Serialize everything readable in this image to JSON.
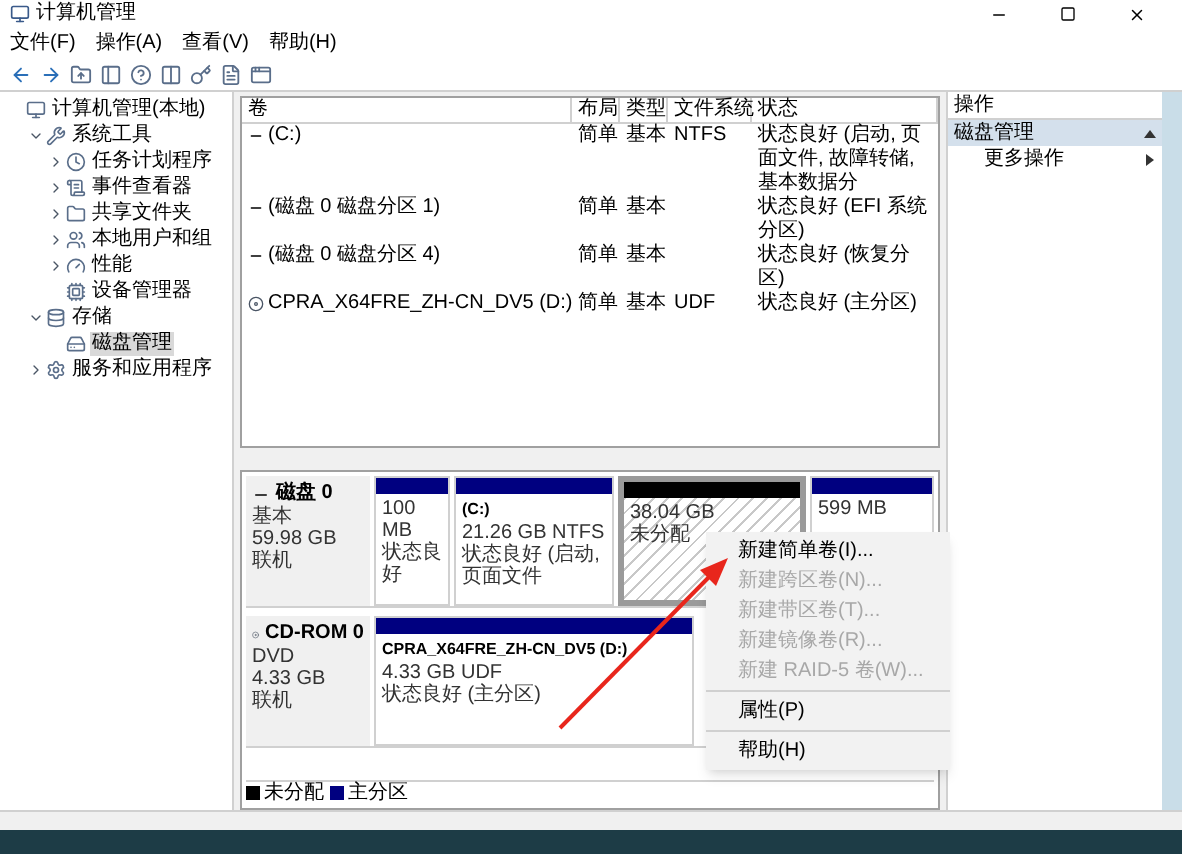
{
  "window": {
    "title": "计算机管理"
  },
  "menu": [
    "文件(F)",
    "操作(A)",
    "查看(V)",
    "帮助(H)"
  ],
  "tree": [
    {
      "label": "计算机管理(本地)",
      "selected": false,
      "children": [
        {
          "label": "系统工具",
          "expanded": true,
          "selected": false,
          "children": [
            {
              "label": "任务计划程序",
              "expanded": false,
              "selected": false
            },
            {
              "label": "事件查看器",
              "expanded": false,
              "selected": false
            },
            {
              "label": "共享文件夹",
              "expanded": false,
              "selected": false
            },
            {
              "label": "本地用户和组",
              "expanded": false,
              "selected": false
            },
            {
              "label": "性能",
              "expanded": false,
              "selected": false
            },
            {
              "label": "设备管理器",
              "selected": false
            }
          ]
        },
        {
          "label": "存储",
          "expanded": true,
          "selected": false,
          "children": [
            {
              "label": "磁盘管理",
              "selected": true
            }
          ]
        },
        {
          "label": "服务和应用程序",
          "expanded": false,
          "selected": false
        }
      ]
    }
  ],
  "table": {
    "columns": [
      "卷",
      "布局",
      "类型",
      "文件系统",
      "状态"
    ],
    "rows": [
      {
        "kind": "partition",
        "cells": [
          "(C:)",
          "简单",
          "基本",
          "NTFS",
          "状态良好 (启动, 页面文件, 故障转储, 基本数据分"
        ]
      },
      {
        "kind": "partition",
        "cells": [
          "(磁盘 0 磁盘分区 1)",
          "简单",
          "基本",
          "",
          "状态良好 (EFI 系统分区)"
        ]
      },
      {
        "kind": "partition",
        "cells": [
          "(磁盘 0 磁盘分区 4)",
          "简单",
          "基本",
          "",
          "状态良好 (恢复分区)"
        ]
      },
      {
        "kind": "cdrom",
        "cells": [
          "CPRA_X64FRE_ZH-CN_DV5 (D:)",
          "简单",
          "基本",
          "UDF",
          "状态良好 (主分区)"
        ]
      }
    ]
  },
  "disks": [
    {
      "kind": "disk",
      "name": "磁盘 0",
      "lines": [
        "基本",
        "59.98 GB",
        "联机"
      ],
      "partitions": [
        {
          "kind": "primary",
          "selected": false,
          "lines": [
            "100 MB",
            "状态良好"
          ]
        },
        {
          "kind": "primary",
          "selected": false,
          "title": "(C:)",
          "lines": [
            "21.26 GB NTFS",
            "状态良好 (启动, 页面文件"
          ]
        },
        {
          "kind": "unallocated",
          "selected": true,
          "lines": [
            "38.04 GB",
            "未分配"
          ]
        },
        {
          "kind": "primary",
          "selected": false,
          "lines": [
            "599 MB"
          ]
        }
      ]
    },
    {
      "kind": "cdrom",
      "name": "CD-ROM 0",
      "lines": [
        "DVD",
        "4.33 GB",
        "联机"
      ],
      "partitions": [
        {
          "kind": "primary",
          "selected": false,
          "title": "CPRA_X64FRE_ZH-CN_DV5  (D:)",
          "lines": [
            "4.33 GB UDF",
            "状态良好 (主分区)"
          ]
        }
      ]
    }
  ],
  "legend": [
    {
      "label": "未分配",
      "color": "#000000"
    },
    {
      "label": "主分区",
      "color": "#000080"
    }
  ],
  "context_menu": [
    [
      {
        "label": "新建简单卷(I)...",
        "disabled": false
      },
      {
        "label": "新建跨区卷(N)...",
        "disabled": true
      },
      {
        "label": "新建带区卷(T)...",
        "disabled": true
      },
      {
        "label": "新建镜像卷(R)...",
        "disabled": true
      },
      {
        "label": "新建 RAID-5 卷(W)...",
        "disabled": true
      }
    ],
    [
      {
        "label": "属性(P)",
        "disabled": false
      }
    ],
    [
      {
        "label": "帮助(H)",
        "disabled": false
      }
    ]
  ],
  "actions": {
    "header": "操作",
    "section": {
      "label": "磁盘管理",
      "expanded": true
    },
    "items": [
      "更多操作"
    ]
  }
}
